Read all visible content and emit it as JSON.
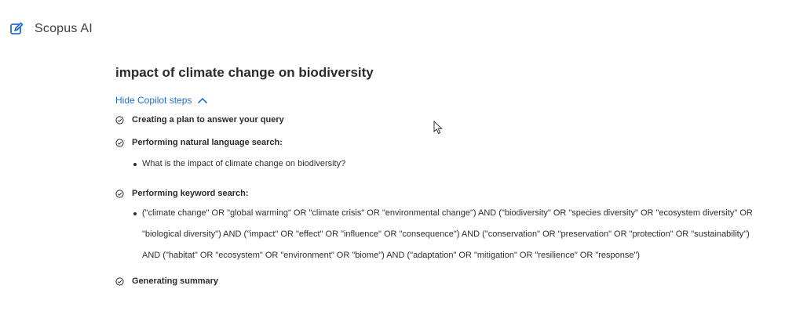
{
  "app": {
    "title": "Scopus AI",
    "icon": "edit-icon"
  },
  "query": {
    "text": "impact of climate change on biodiversity"
  },
  "copilot": {
    "toggle_label": "Hide Copilot steps",
    "toggle_icon": "chevron-up-icon",
    "steps": [
      {
        "label": "Creating a plan to answer your query",
        "icon": "check-circle-icon"
      },
      {
        "label": "Performing natural language search:",
        "icon": "check-circle-icon",
        "items": [
          "What is the impact of climate change on biodiversity?"
        ]
      },
      {
        "label": "Performing keyword search:",
        "icon": "check-circle-icon",
        "items": [
          "(\"climate change\" OR \"global warming\" OR \"climate crisis\" OR \"environmental change\") AND (\"biodiversity\" OR \"species diversity\" OR \"ecosystem diversity\" OR \"biological diversity\") AND (\"impact\" OR \"effect\" OR \"influence\" OR \"consequence\") AND (\"conservation\" OR \"preservation\" OR \"protection\" OR \"sustainability\") AND (\"habitat\" OR \"ecosystem\" OR \"environment\" OR \"biome\") AND (\"adaptation\" OR \"mitigation\" OR \"resilience\" OR \"response\")"
        ]
      },
      {
        "label": "Generating summary",
        "icon": "check-circle-icon"
      }
    ]
  },
  "colors": {
    "link": "#1f6fd1",
    "icon": "#1f6fd1",
    "text": "#2b2b2b"
  }
}
